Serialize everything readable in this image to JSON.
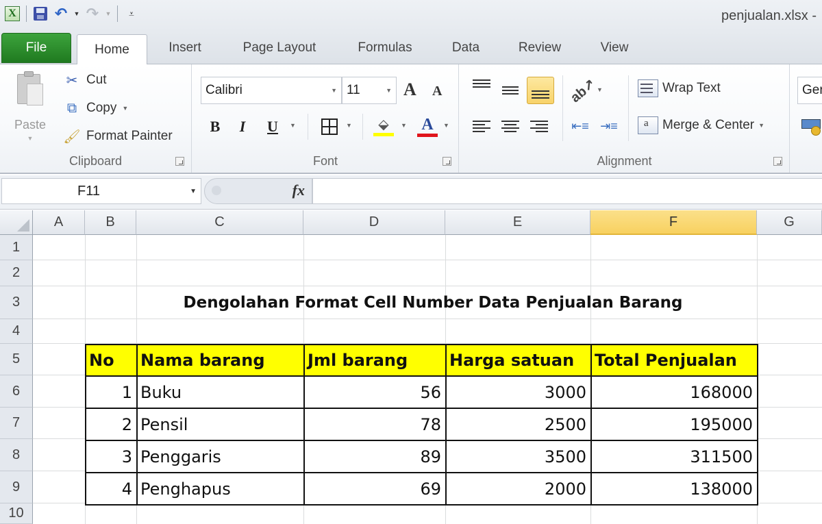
{
  "app": {
    "window_title": "penjualan.xlsx  -",
    "quick_access": {
      "logo_icon": "excel-logo-icon",
      "save_icon": "save-icon",
      "undo_icon": "undo-icon",
      "redo_icon": "redo-icon",
      "customize_icon": "customize-toolbar-icon"
    }
  },
  "tabs": [
    {
      "label": "File"
    },
    {
      "label": "Home",
      "active": true
    },
    {
      "label": "Insert"
    },
    {
      "label": "Page Layout"
    },
    {
      "label": "Formulas"
    },
    {
      "label": "Data"
    },
    {
      "label": "Review"
    },
    {
      "label": "View"
    }
  ],
  "ribbon": {
    "clipboard": {
      "label": "Clipboard",
      "paste": "Paste",
      "cut": "Cut",
      "copy": "Copy",
      "format_painter": "Format Painter"
    },
    "font": {
      "label": "Font",
      "font_name": "Calibri",
      "font_size": "11",
      "bold": "B",
      "italic": "I",
      "underline": "U",
      "font_color_glyph": "A",
      "grow_glyph": "A",
      "shrink_glyph": "A",
      "fill_color": "#ffff00",
      "font_color": "#e0151c"
    },
    "alignment": {
      "label": "Alignment",
      "wrap_text": "Wrap Text",
      "merge_center": "Merge & Center",
      "active_button": "bottom-align"
    },
    "number": {
      "format": "General",
      "format_visible": "Ger"
    }
  },
  "formula_bar": {
    "name_box": "F11",
    "fx_label": "fx",
    "formula": ""
  },
  "sheet": {
    "columns": [
      "A",
      "B",
      "C",
      "D",
      "E",
      "F",
      "G"
    ],
    "selected_column": "F",
    "rows": [
      "1",
      "2",
      "3",
      "4",
      "5",
      "6",
      "7",
      "8",
      "9",
      "10"
    ],
    "title": "Dengolahan Format Cell Number Data Penjualan Barang",
    "table": {
      "headers": [
        "No",
        "Nama barang",
        "Jml barang",
        "Harga satuan",
        "Total Penjualan"
      ],
      "header_color": "#ffff00",
      "rows": [
        [
          "1",
          "Buku",
          "56",
          "3000",
          "168000"
        ],
        [
          "2",
          "Pensil",
          "78",
          "2500",
          "195000"
        ],
        [
          "3",
          "Penggaris",
          "89",
          "3500",
          "311500"
        ],
        [
          "4",
          "Penghapus",
          "69",
          "2000",
          "138000"
        ]
      ]
    }
  }
}
